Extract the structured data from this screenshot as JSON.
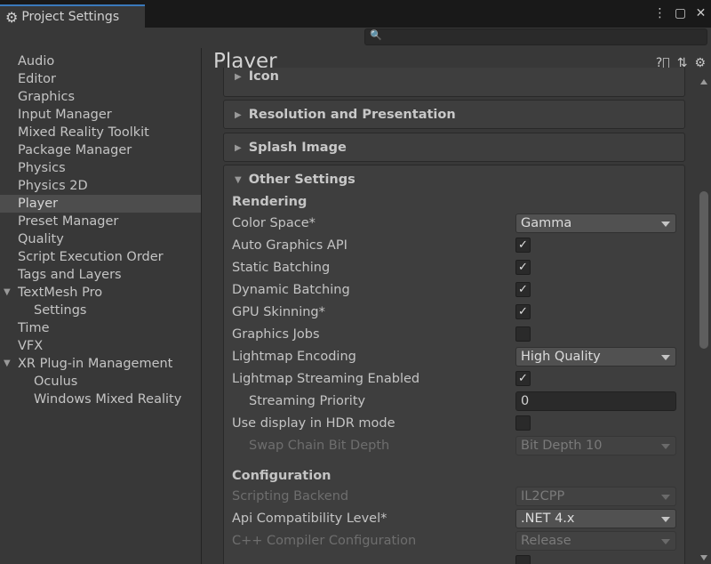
{
  "window": {
    "title": "Project Settings"
  },
  "search": {
    "placeholder": ""
  },
  "sidebar": {
    "items": [
      {
        "label": "Audio"
      },
      {
        "label": "Editor"
      },
      {
        "label": "Graphics"
      },
      {
        "label": "Input Manager"
      },
      {
        "label": "Mixed Reality Toolkit"
      },
      {
        "label": "Package Manager"
      },
      {
        "label": "Physics"
      },
      {
        "label": "Physics 2D"
      },
      {
        "label": "Player"
      },
      {
        "label": "Preset Manager"
      },
      {
        "label": "Quality"
      },
      {
        "label": "Script Execution Order"
      },
      {
        "label": "Tags and Layers"
      },
      {
        "label": "TextMesh Pro"
      },
      {
        "label": "Settings"
      },
      {
        "label": "Time"
      },
      {
        "label": "VFX"
      },
      {
        "label": "XR Plug-in Management"
      },
      {
        "label": "Oculus"
      },
      {
        "label": "Windows Mixed Reality"
      }
    ]
  },
  "main": {
    "title": "Player",
    "foldouts": {
      "icon": "Icon",
      "resolution": "Resolution and Presentation",
      "splash": "Splash Image",
      "other": "Other Settings"
    },
    "rendering": {
      "header": "Rendering",
      "color_space_label": "Color Space*",
      "color_space_value": "Gamma",
      "auto_graphics_api_label": "Auto Graphics API",
      "static_batching_label": "Static Batching",
      "dynamic_batching_label": "Dynamic Batching",
      "gpu_skinning_label": "GPU Skinning*",
      "graphics_jobs_label": "Graphics Jobs",
      "lightmap_encoding_label": "Lightmap Encoding",
      "lightmap_encoding_value": "High Quality",
      "lightmap_streaming_label": "Lightmap Streaming Enabled",
      "streaming_priority_label": "Streaming Priority",
      "streaming_priority_value": "0",
      "hdr_label": "Use display in HDR mode",
      "swap_chain_label": "Swap Chain Bit Depth",
      "swap_chain_value": "Bit Depth 10"
    },
    "configuration": {
      "header": "Configuration",
      "scripting_backend_label": "Scripting Backend",
      "scripting_backend_value": "IL2CPP",
      "api_compat_label": "Api Compatibility Level*",
      "api_compat_value": ".NET 4.x",
      "cpp_compiler_label": "C++ Compiler Configuration",
      "cpp_compiler_value": "Release"
    },
    "checked_mark": "✓"
  }
}
